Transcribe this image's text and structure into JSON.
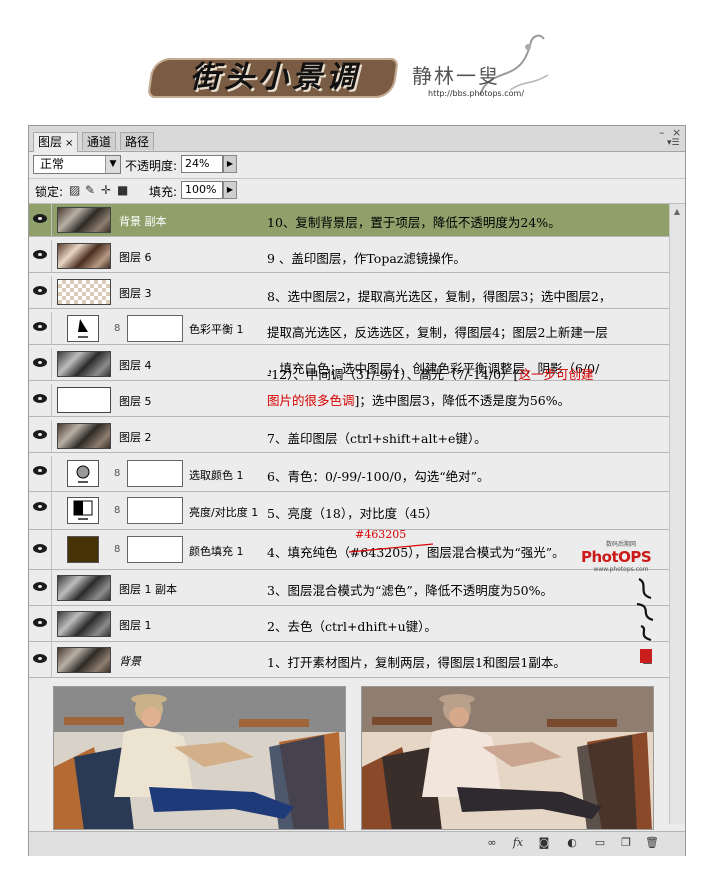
{
  "header": {
    "title": "街头小景调",
    "signature": "静林一叟",
    "url": "http://bbs.photops.com/"
  },
  "tabs": [
    {
      "label": "图层",
      "active": true
    },
    {
      "label": "通道",
      "active": false
    },
    {
      "label": "路径",
      "active": false
    }
  ],
  "blend_mode": "正常",
  "opacity_label": "不透明度:",
  "opacity_value": "24%",
  "lock_label": "锁定:",
  "fill_label": "填充:",
  "fill_value": "100%",
  "layers": [
    {
      "name": "背景 副本",
      "selected": true,
      "thumb": "photo",
      "note": "10、复制背景层，置于项层，降低不透明度为24%。"
    },
    {
      "name": "图层 6",
      "thumb": "photo-warm",
      "note": "9 、盖印图层，作Topaz滤镜操作。"
    },
    {
      "name": "图层 3",
      "thumb": "checker",
      "note": "8、选中图层2，提取高光选区，复制，得图层3；选中图层2，"
    },
    {
      "name": "色彩平衡 1",
      "thumb": "adjustment",
      "icon": "color-balance-icon",
      "note": "提取高光选区，反选选区，复制，得图层4；图层2上新建一层"
    },
    {
      "name": "图层 4",
      "thumb": "photo-gray",
      "note": "，填充白色；选中图层4，创建色彩平衡调整层，阴影（6/0/"
    },
    {
      "name": "图层 5",
      "thumb": "white",
      "note": "-12）、中间调（31/-9/1）、高光（7/-14/0）[这一步可创建"
    },
    {
      "name": "图层 2",
      "thumb": "photo",
      "note": "7、盖印图层（ctrl+shift+alt+e键）。"
    },
    {
      "name": "选取颜色 1",
      "thumb": "adjustment",
      "icon": "selective-color-icon",
      "note": "6、青色：0/-99/-100/0，勾选“绝对”。"
    },
    {
      "name": "亮度/对比度 1",
      "thumb": "adjustment",
      "icon": "brightness-contrast-icon",
      "note": "5、亮度（18），对比度（45）"
    },
    {
      "name": "颜色填充 1",
      "thumb": "fill",
      "icon": "color-fill-icon",
      "note": "4、填充纯色（#643205），图层混合模式为“强光”。"
    },
    {
      "name": "图层 1 副本",
      "thumb": "photo-gray",
      "note": "3、图层混合模式为“滤色”，降低不透明度为50%。"
    },
    {
      "name": "图层 1",
      "thumb": "photo-gray",
      "note": "2、去色（ctrl+dhift+u键）。"
    },
    {
      "name": "背景",
      "thumb": "photo",
      "italic": true,
      "locked": true,
      "note": "1、打开素材图片，复制两层，得图层1和图层1副本。"
    }
  ],
  "note8_line5_red": "图片的很多色调",
  "note8_line5_rest": "]；选中图层3，降低不透是度为56%。",
  "note8_line4_prefix": "-12）、中间调（31/-9/1）、高光（7/-14/0）[",
  "note8_line4_red": "这一步可创建",
  "correction": "#463205",
  "brand_small": "数码后期网",
  "brand": "PhotOPS",
  "brand_url": "www.photops.com",
  "fill_color": "#463205",
  "selected_color": "#8fa06a"
}
